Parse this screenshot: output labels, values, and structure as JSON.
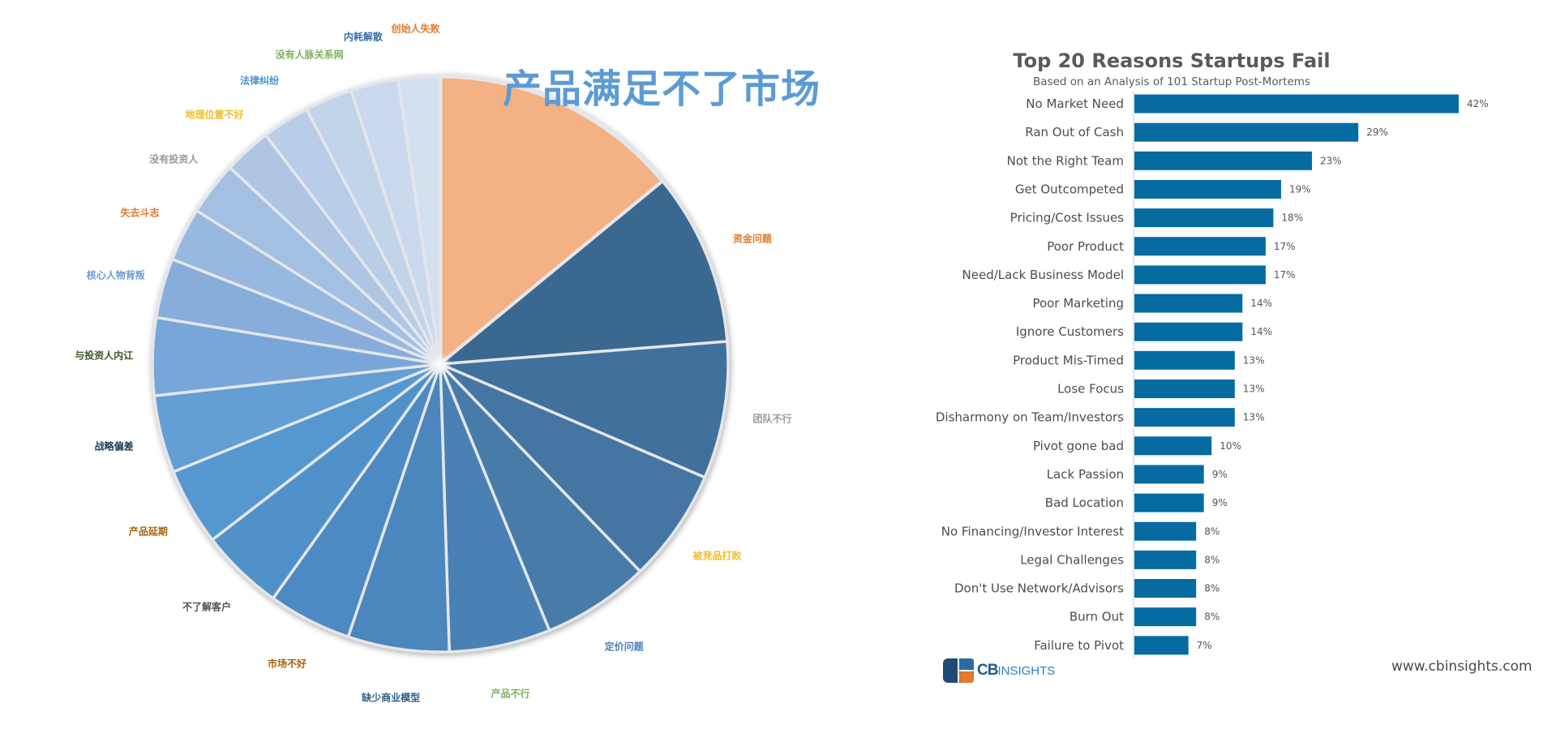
{
  "pie": {
    "title": "产品满足不了市场",
    "title_color": "#5b9bd5"
  },
  "bar_header": {
    "title": "Top 20 Reasons Startups Fail",
    "subtitle": "Based on an Analysis of 101 Startup Post-Mortems"
  },
  "footer": {
    "logo_cb": "CB",
    "logo_insights": "INSIGHTS",
    "url": "www.cbinsights.com"
  },
  "chart_data": [
    {
      "type": "pie",
      "title": "产品满足不了市场",
      "start": "top",
      "direction": "clockwise",
      "slices": [
        {
          "label": "产品满足不了市场",
          "value": 42,
          "color": "#f3b184",
          "label_color": "#5b9bd5"
        },
        {
          "label": "资金问题",
          "value": 29,
          "color": "#3b6891",
          "label_color": "#e07b2c"
        },
        {
          "label": "团队不行",
          "value": 23,
          "color": "#41709c",
          "label_color": "#9a9a9a"
        },
        {
          "label": "被竞品打败",
          "value": 19,
          "color": "#4474a3",
          "label_color": "#f2bf27"
        },
        {
          "label": "定价问题",
          "value": 18,
          "color": "#477ba9",
          "label_color": "#4a7fbf"
        },
        {
          "label": "产品不行",
          "value": 17,
          "color": "#4a81b4",
          "label_color": "#7fb15c"
        },
        {
          "label": "缺少商业模型",
          "value": 17,
          "color": "#4c86bc",
          "label_color": "#2f5f8a"
        },
        {
          "label": "市场不好",
          "value": 14,
          "color": "#4e89c2",
          "label_color": "#a8630a"
        },
        {
          "label": "不了解客户",
          "value": 14,
          "color": "#5191ca",
          "label_color": "#555555"
        },
        {
          "label": "产品延期",
          "value": 13,
          "color": "#5598d0",
          "label_color": "#a8630a"
        },
        {
          "label": "战略偏差",
          "value": 13,
          "color": "#649ed4",
          "label_color": "#1f3b5a"
        },
        {
          "label": "与投资人内讧",
          "value": 13,
          "color": "#78a6d8",
          "label_color": "#3a5a2a"
        },
        {
          "label": "核心人物背叛",
          "value": 10,
          "color": "#88addb",
          "label_color": "#6d9bd0"
        },
        {
          "label": "失去斗志",
          "value": 9,
          "color": "#97b8df",
          "label_color": "#e07b2c"
        },
        {
          "label": "没有投资人",
          "value": 9,
          "color": "#a3bfe1",
          "label_color": "#9a9a9a"
        },
        {
          "label": "地理位置不好",
          "value": 8,
          "color": "#aec6e4",
          "label_color": "#f2bf27"
        },
        {
          "label": "法律纠纷",
          "value": 8,
          "color": "#b8cde7",
          "label_color": "#4a8fd0"
        },
        {
          "label": "没有人脉关系网",
          "value": 8,
          "color": "#c2d4ea",
          "label_color": "#7fb15c"
        },
        {
          "label": "内耗解散",
          "value": 8,
          "color": "#cad9ed",
          "label_color": "#3a6fa8"
        },
        {
          "label": "创始人失败",
          "value": 7,
          "color": "#d3e0f0",
          "label_color": "#e07b2c"
        }
      ]
    },
    {
      "type": "bar",
      "orientation": "horizontal",
      "title": "Top 20 Reasons Startups Fail",
      "subtitle": "Based on an Analysis of 101 Startup Post-Mortems",
      "xlabel": "",
      "ylabel": "",
      "xlim": [
        0,
        42
      ],
      "grid": false,
      "bar_color": "#056ba0",
      "value_suffix": "%",
      "categories": [
        "No Market Need",
        "Ran Out of Cash",
        "Not the Right Team",
        "Get Outcompeted",
        "Pricing/Cost Issues",
        "Poor Product",
        "Need/Lack Business Model",
        "Poor Marketing",
        "Ignore Customers",
        "Product Mis-Timed",
        "Lose Focus",
        "Disharmony on Team/Investors",
        "Pivot gone bad",
        "Lack Passion",
        "Bad Location",
        "No Financing/Investor Interest",
        "Legal Challenges",
        "Don't Use Network/Advisors",
        "Burn Out",
        "Failure to Pivot"
      ],
      "values": [
        42,
        29,
        23,
        19,
        18,
        17,
        17,
        14,
        14,
        13,
        13,
        13,
        10,
        9,
        9,
        8,
        8,
        8,
        8,
        7
      ],
      "data_labels": [
        "42%",
        "29%",
        "23%",
        "19%",
        "18%",
        "17%",
        "17%",
        "14%",
        "14%",
        "13%",
        "13%",
        "13%",
        "10%",
        "9%",
        "9%",
        "8%",
        "8%",
        "8%",
        "8%",
        "7%"
      ]
    }
  ]
}
